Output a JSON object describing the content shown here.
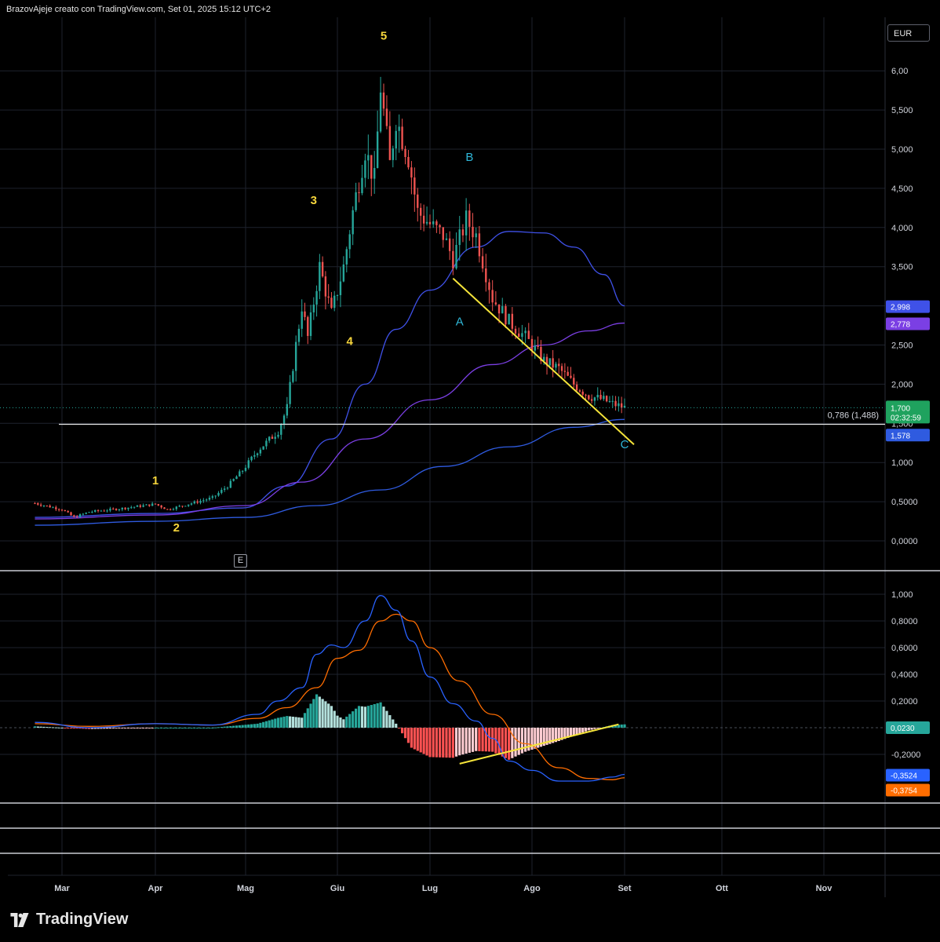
{
  "header": {
    "caption": "BrazovAjeje creato con TradingView.com, Set 01, 2025 15:12 UTC+2"
  },
  "price_pane": {
    "currency": "EUR",
    "earnings_marker": "E"
  },
  "brand": {
    "name": "TradingView"
  },
  "colors": {
    "up": "#26a69a",
    "down": "#ef5350",
    "ma_fast": "#3f51e8",
    "ma_mid": "#7b3fe4",
    "ma_slow": "#2f5be0",
    "wave_yellow": "#f7d63c",
    "wave_cyan": "#2fb7d8",
    "trendline": "#f5e43a",
    "macd": "#2962ff",
    "signal": "#ff6d00",
    "hist_pos_strong": "#26a69a",
    "hist_pos_weak": "#b2dfdb",
    "hist_neg_strong": "#ff5252",
    "hist_neg_weak": "#ffcdd2"
  },
  "chart_data": [
    {
      "type": "candlestick",
      "x_axis": {
        "labels": [
          "Mar",
          "Apr",
          "Mag",
          "Giu",
          "Lug",
          "Ago",
          "Set",
          "Ott",
          "Nov"
        ]
      },
      "ylim": [
        0,
        6.0
      ],
      "y_ticks": [
        "0,0000",
        "0,5000",
        "1,000",
        "1,500",
        "2,000",
        "2,500",
        "3,000",
        "3,500",
        "4,000",
        "4,500",
        "5,000",
        "5,500",
        "6,00"
      ],
      "grid": true,
      "anchors": [
        {
          "d": "02-20",
          "v": 0.48
        },
        {
          "d": "03-01",
          "v": 0.4
        },
        {
          "d": "03-05",
          "v": 0.3
        },
        {
          "d": "03-10",
          "v": 0.37
        },
        {
          "d": "03-20",
          "v": 0.41
        },
        {
          "d": "04-01",
          "v": 0.47
        },
        {
          "d": "04-05",
          "v": 0.4
        },
        {
          "d": "04-10",
          "v": 0.45
        },
        {
          "d": "04-20",
          "v": 0.55
        },
        {
          "d": "04-25",
          "v": 0.7
        },
        {
          "d": "04-30",
          "v": 0.9
        },
        {
          "d": "05-05",
          "v": 1.15
        },
        {
          "d": "05-12",
          "v": 1.4
        },
        {
          "d": "05-15",
          "v": 1.7
        },
        {
          "d": "05-18",
          "v": 2.5
        },
        {
          "d": "05-20",
          "v": 3.0
        },
        {
          "d": "05-22",
          "v": 2.6
        },
        {
          "d": "05-26",
          "v": 3.5
        },
        {
          "d": "05-30",
          "v": 2.9
        },
        {
          "d": "06-03",
          "v": 3.5
        },
        {
          "d": "06-06",
          "v": 4.2
        },
        {
          "d": "06-10",
          "v": 5.0
        },
        {
          "d": "06-13",
          "v": 4.6
        },
        {
          "d": "06-15",
          "v": 5.8
        },
        {
          "d": "06-18",
          "v": 4.8
        },
        {
          "d": "06-20",
          "v": 5.4
        },
        {
          "d": "06-24",
          "v": 4.9
        },
        {
          "d": "06-27",
          "v": 4.2
        },
        {
          "d": "07-02",
          "v": 4.0
        },
        {
          "d": "07-05",
          "v": 3.9
        },
        {
          "d": "07-08",
          "v": 3.6
        },
        {
          "d": "07-12",
          "v": 4.1
        },
        {
          "d": "07-15",
          "v": 3.9
        },
        {
          "d": "07-20",
          "v": 3.1
        },
        {
          "d": "07-25",
          "v": 2.8
        },
        {
          "d": "07-30",
          "v": 2.6
        },
        {
          "d": "08-05",
          "v": 2.3
        },
        {
          "d": "08-10",
          "v": 2.2
        },
        {
          "d": "08-15",
          "v": 2.0
        },
        {
          "d": "08-20",
          "v": 1.85
        },
        {
          "d": "08-25",
          "v": 1.8
        },
        {
          "d": "08-28",
          "v": 1.75
        },
        {
          "d": "09-01",
          "v": 1.7
        }
      ],
      "last_price": "1,700",
      "countdown": "02:32:59",
      "moving_averages": [
        {
          "color_key": "ma_fast",
          "last_value": "2,998",
          "points": [
            {
              "d": "02-20",
              "v": 0.3
            },
            {
              "d": "04-01",
              "v": 0.35
            },
            {
              "d": "04-30",
              "v": 0.42
            },
            {
              "d": "05-15",
              "v": 0.7
            },
            {
              "d": "05-30",
              "v": 1.3
            },
            {
              "d": "06-10",
              "v": 2.0
            },
            {
              "d": "06-20",
              "v": 2.7
            },
            {
              "d": "07-01",
              "v": 3.2
            },
            {
              "d": "07-15",
              "v": 3.75
            },
            {
              "d": "07-25",
              "v": 3.95
            },
            {
              "d": "08-05",
              "v": 3.93
            },
            {
              "d": "08-15",
              "v": 3.75
            },
            {
              "d": "08-25",
              "v": 3.4
            },
            {
              "d": "09-01",
              "v": 3.0
            }
          ]
        },
        {
          "color_key": "ma_mid",
          "last_value": "2,778",
          "points": [
            {
              "d": "02-20",
              "v": 0.28
            },
            {
              "d": "04-01",
              "v": 0.33
            },
            {
              "d": "05-01",
              "v": 0.45
            },
            {
              "d": "05-20",
              "v": 0.75
            },
            {
              "d": "06-10",
              "v": 1.3
            },
            {
              "d": "07-01",
              "v": 1.8
            },
            {
              "d": "07-20",
              "v": 2.25
            },
            {
              "d": "08-05",
              "v": 2.5
            },
            {
              "d": "08-20",
              "v": 2.68
            },
            {
              "d": "09-01",
              "v": 2.78
            }
          ]
        },
        {
          "color_key": "ma_slow",
          "last_value": "1,578",
          "points": [
            {
              "d": "02-20",
              "v": 0.2
            },
            {
              "d": "04-01",
              "v": 0.25
            },
            {
              "d": "05-01",
              "v": 0.3
            },
            {
              "d": "05-25",
              "v": 0.45
            },
            {
              "d": "06-15",
              "v": 0.65
            },
            {
              "d": "07-05",
              "v": 0.95
            },
            {
              "d": "07-25",
              "v": 1.2
            },
            {
              "d": "08-15",
              "v": 1.45
            },
            {
              "d": "09-01",
              "v": 1.55
            }
          ]
        }
      ],
      "fib_level": {
        "label": "0,786 (1,488)",
        "value": 1.488
      },
      "trendline": {
        "from": {
          "d": "07-08",
          "v": 3.35
        },
        "to": {
          "d": "09-01",
          "v": 1.23
        }
      },
      "wave_labels": [
        {
          "text": "1",
          "d": "04-01",
          "v": 0.72,
          "color_key": "wave_yellow"
        },
        {
          "text": "2",
          "d": "04-08",
          "v": 0.12,
          "color_key": "wave_yellow"
        },
        {
          "text": "3",
          "d": "05-24",
          "v": 4.3,
          "color_key": "wave_yellow"
        },
        {
          "text": "4",
          "d": "06-05",
          "v": 2.5,
          "color_key": "wave_yellow"
        },
        {
          "text": "5",
          "d": "06-16",
          "v": 6.4,
          "color_key": "wave_yellow"
        },
        {
          "text": "A",
          "d": "07-10",
          "v": 2.75,
          "color_key": "wave_cyan"
        },
        {
          "text": "B",
          "d": "07-13",
          "v": 4.85,
          "color_key": "wave_cyan"
        },
        {
          "text": "C",
          "d": "09-01",
          "v": 1.18,
          "color_key": "wave_cyan"
        }
      ]
    },
    {
      "type": "macd",
      "ylim": [
        -0.42,
        1.02
      ],
      "y_ticks": [
        "-0,2000",
        "0,2000",
        "0,4000",
        "0,6000",
        "0,8000",
        "1,000"
      ],
      "macd_last": "-0,3524",
      "signal_last": "-0,3754",
      "histogram_last": "0,0230",
      "macd": [
        {
          "d": "02-20",
          "v": 0.04
        },
        {
          "d": "03-10",
          "v": 0.0
        },
        {
          "d": "04-01",
          "v": 0.03
        },
        {
          "d": "04-20",
          "v": 0.02
        },
        {
          "d": "05-05",
          "v": 0.1
        },
        {
          "d": "05-12",
          "v": 0.2
        },
        {
          "d": "05-20",
          "v": 0.3
        },
        {
          "d": "05-25",
          "v": 0.55
        },
        {
          "d": "05-30",
          "v": 0.62
        },
        {
          "d": "06-03",
          "v": 0.6
        },
        {
          "d": "06-10",
          "v": 0.8
        },
        {
          "d": "06-15",
          "v": 0.99
        },
        {
          "d": "06-20",
          "v": 0.88
        },
        {
          "d": "06-25",
          "v": 0.65
        },
        {
          "d": "07-01",
          "v": 0.38
        },
        {
          "d": "07-08",
          "v": 0.18
        },
        {
          "d": "07-15",
          "v": 0.05
        },
        {
          "d": "07-20",
          "v": -0.08
        },
        {
          "d": "07-25",
          "v": -0.25
        },
        {
          "d": "08-01",
          "v": -0.32
        },
        {
          "d": "08-10",
          "v": -0.4
        },
        {
          "d": "08-20",
          "v": -0.4
        },
        {
          "d": "08-28",
          "v": -0.37
        },
        {
          "d": "09-01",
          "v": -0.35
        }
      ],
      "signal": [
        {
          "d": "02-20",
          "v": 0.03
        },
        {
          "d": "03-10",
          "v": 0.01
        },
        {
          "d": "04-01",
          "v": 0.03
        },
        {
          "d": "04-20",
          "v": 0.02
        },
        {
          "d": "05-05",
          "v": 0.07
        },
        {
          "d": "05-15",
          "v": 0.15
        },
        {
          "d": "05-25",
          "v": 0.3
        },
        {
          "d": "06-01",
          "v": 0.52
        },
        {
          "d": "06-08",
          "v": 0.58
        },
        {
          "d": "06-15",
          "v": 0.8
        },
        {
          "d": "06-20",
          "v": 0.85
        },
        {
          "d": "06-25",
          "v": 0.8
        },
        {
          "d": "07-01",
          "v": 0.6
        },
        {
          "d": "07-10",
          "v": 0.35
        },
        {
          "d": "07-20",
          "v": 0.1
        },
        {
          "d": "07-30",
          "v": -0.12
        },
        {
          "d": "08-10",
          "v": -0.3
        },
        {
          "d": "08-20",
          "v": -0.38
        },
        {
          "d": "08-28",
          "v": -0.39
        },
        {
          "d": "09-01",
          "v": -0.375
        }
      ],
      "trendline": {
        "from": {
          "d": "07-10",
          "v": -0.27
        },
        "to": {
          "d": "08-30",
          "v": 0.025
        }
      }
    }
  ]
}
